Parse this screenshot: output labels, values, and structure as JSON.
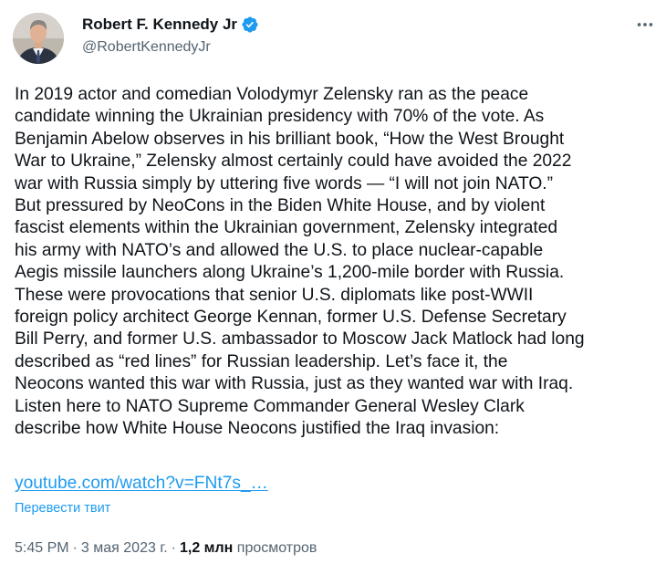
{
  "author": {
    "display_name": "Robert F. Kennedy Jr",
    "handle": "@RobertKennedyJr",
    "verified": true,
    "verified_color": "#1d9bf0",
    "avatar_icon": "profile-photo"
  },
  "tweet": {
    "text": "In 2019 actor and comedian Volodymyr Zelensky ran as the peace\ncandidate winning the Ukrainian presidency with 70% of the vote. As\nBenjamin Abelow observes in his brilliant book, “How the West Brought\nWar to Ukraine,” Zelensky almost certainly could have avoided the 2022\nwar with Russia simply by uttering five words — “I will not join NATO.”\nBut pressured by NeoCons in the Biden White House, and by violent\nfascist elements within the Ukrainian government, Zelensky integrated\nhis army with NATO’s and allowed the U.S. to place nuclear-capable\nAegis missile launchers along Ukraine’s 1,200-mile border with Russia.\nThese were provocations that senior U.S. diplomats like post-WWII\nforeign policy architect George Kennan, former U.S. Defense Secretary\nBill Perry, and former U.S. ambassador to Moscow Jack Matlock had long\ndescribed as “red lines” for Russian leadership. Let’s face it, the\nNeocons wanted this war with Russia, just as they wanted war with Iraq.\nListen here to NATO Supreme Commander General Wesley Clark\ndescribe how White House Neocons justified the Iraq invasion:",
    "link_text": "youtube.com/watch?v=FNt7s_…",
    "translate_label": "Перевести твит",
    "link_color": "#1d9bf0"
  },
  "meta": {
    "time": "5:45 PM",
    "separator": "·",
    "date": "3 мая 2023 г.",
    "views_count": "1,2 млн",
    "views_label": "просмотров"
  },
  "icons": {
    "more": "more-icon",
    "verified": "verified-badge-icon"
  }
}
